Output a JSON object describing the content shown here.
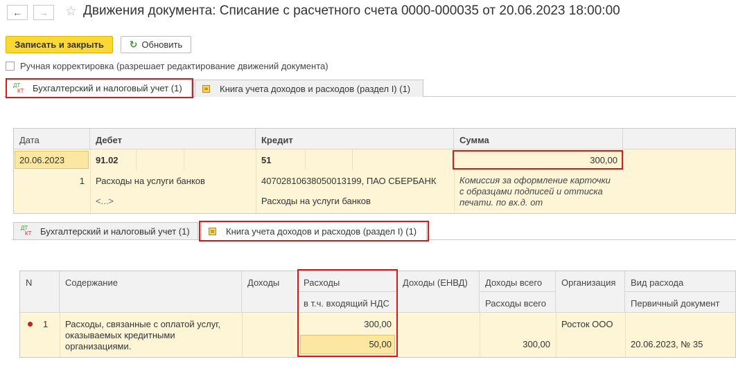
{
  "window": {
    "back_icon": "arrow-left-icon",
    "forward_icon": "arrow-right-icon",
    "favorite_icon": "star-icon",
    "title": "Движения документа: Списание с расчетного счета 0000-000035 от 20.06.2023 18:00:00"
  },
  "toolbar": {
    "save_close_label": "Записать и закрыть",
    "refresh_label": "Обновить"
  },
  "manual_edit": {
    "label": "Ручная корректировка (разрешает редактирование движений документа)",
    "checked": false
  },
  "tabs_top": [
    {
      "icon": "dt-kt-icon",
      "icon_dt": "ДТ",
      "icon_kt": "КТ",
      "label": "Бухгалтерский и налоговый учет (1)",
      "active": true
    },
    {
      "icon": "book-icon",
      "label": "Книга учета доходов и расходов (раздел I) (1)",
      "active": false
    }
  ],
  "accounting_table": {
    "headers": [
      "Дата",
      "Дебет",
      "Кредит",
      "Сумма"
    ],
    "row": {
      "date": "20.06.2023",
      "debit_account": "91.02",
      "credit_account": "51",
      "amount": "300,00",
      "row_number": "1",
      "debit_subconto1": "Расходы на услуги банков",
      "debit_subconto2": "<...>",
      "credit_subconto1": "40702810638050013199, ПАО СБЕРБАНК",
      "credit_subconto2": "Расходы на услуги банков",
      "comment_line1": "Комиссия за оформление карточки",
      "comment_line2": "с образцами подписей и оттиска",
      "comment_line3": "печати. по вх.д.  от"
    }
  },
  "tabs_bottom": [
    {
      "icon": "dt-kt-icon",
      "icon_dt": "ДТ",
      "icon_kt": "КТ",
      "label": "Бухгалтерский и налоговый учет (1)",
      "active": false
    },
    {
      "icon": "book-icon",
      "label": "Книга учета доходов и расходов (раздел I) (1)",
      "active": true
    }
  ],
  "kudir_table": {
    "headers": {
      "n": "N",
      "content": "Содержание",
      "income": "Доходы",
      "expenses": "Расходы",
      "expenses_sub": "в т.ч. входящий НДС",
      "income_envd": "Доходы (ЕНВД)",
      "income_total": "Доходы всего",
      "expenses_total": "Расходы всего",
      "organization": "Организация",
      "expense_type": "Вид расхода",
      "primary_doc": "Первичный документ"
    },
    "row": {
      "n": "1",
      "content_line1": "Расходы, связанные с оплатой услуг,",
      "content_line2": "оказываемых кредитными",
      "content_line3": "организациями.",
      "expenses": "300,00",
      "incoming_vat": "50,00",
      "expenses_total": "300,00",
      "organization": "Росток ООО",
      "primary_doc": "20.06.2023, № 35"
    }
  }
}
